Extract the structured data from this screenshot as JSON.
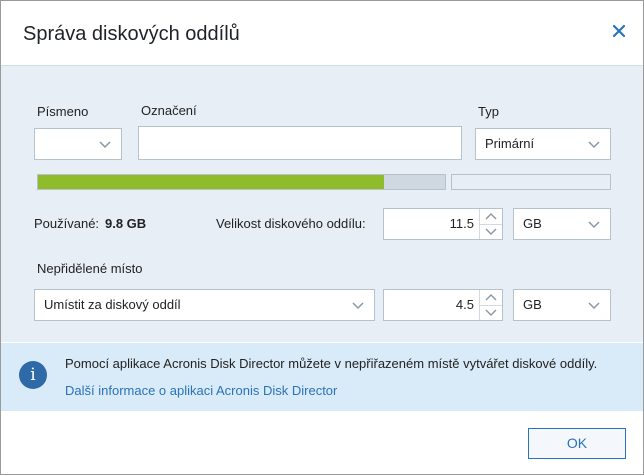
{
  "dialog": {
    "title": "Správa diskových oddílů"
  },
  "fields": {
    "letter_label": "Písmeno",
    "letter_value": "",
    "label_label": "Označení",
    "label_value": "",
    "type_label": "Typ",
    "type_value": "Primární"
  },
  "usage": {
    "used_label": "Používané:",
    "used_value": "9.8 GB",
    "used_fraction": 0.85
  },
  "size": {
    "label": "Velikost diskového oddílu:",
    "value": "11.5",
    "unit": "GB"
  },
  "unallocated": {
    "label": "Nepřidělené místo",
    "placement": "Umístit za diskový oddíl",
    "value": "4.5",
    "unit": "GB"
  },
  "info": {
    "text": "Pomocí aplikace Acronis Disk Director můžete v nepřiřazeném místě vytvářet diskové oddíly.",
    "link": "Další informace o aplikaci Acronis Disk Director"
  },
  "buttons": {
    "ok": "OK"
  },
  "colors": {
    "accent": "#2a73b8",
    "bar_fill": "#8fbc2b",
    "panel_bg": "#e8eef5",
    "info_bg": "#d9ebf8"
  }
}
